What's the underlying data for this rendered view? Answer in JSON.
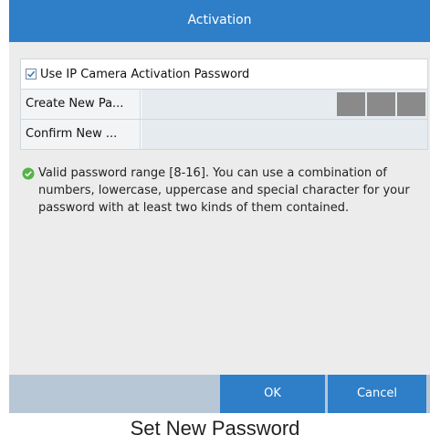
{
  "dialog": {
    "title": "Activation",
    "checkbox": {
      "label": "Use IP Camera Activation Password",
      "checked": true
    },
    "fields": [
      {
        "label": "Create New Pa...",
        "value": ""
      },
      {
        "label": "Confirm New ...",
        "value": ""
      }
    ],
    "strength_color": "#8a8a8a",
    "info": {
      "icon": "check-circle-icon",
      "text": "Valid password range [8-16]. You can use a combination of numbers, lowercase, uppercase and special character for your password with at least two kinds of them contained."
    },
    "buttons": {
      "ok": "OK",
      "cancel": "Cancel"
    },
    "accent_color": "#2e7ec8"
  },
  "caption": "Set New Password"
}
